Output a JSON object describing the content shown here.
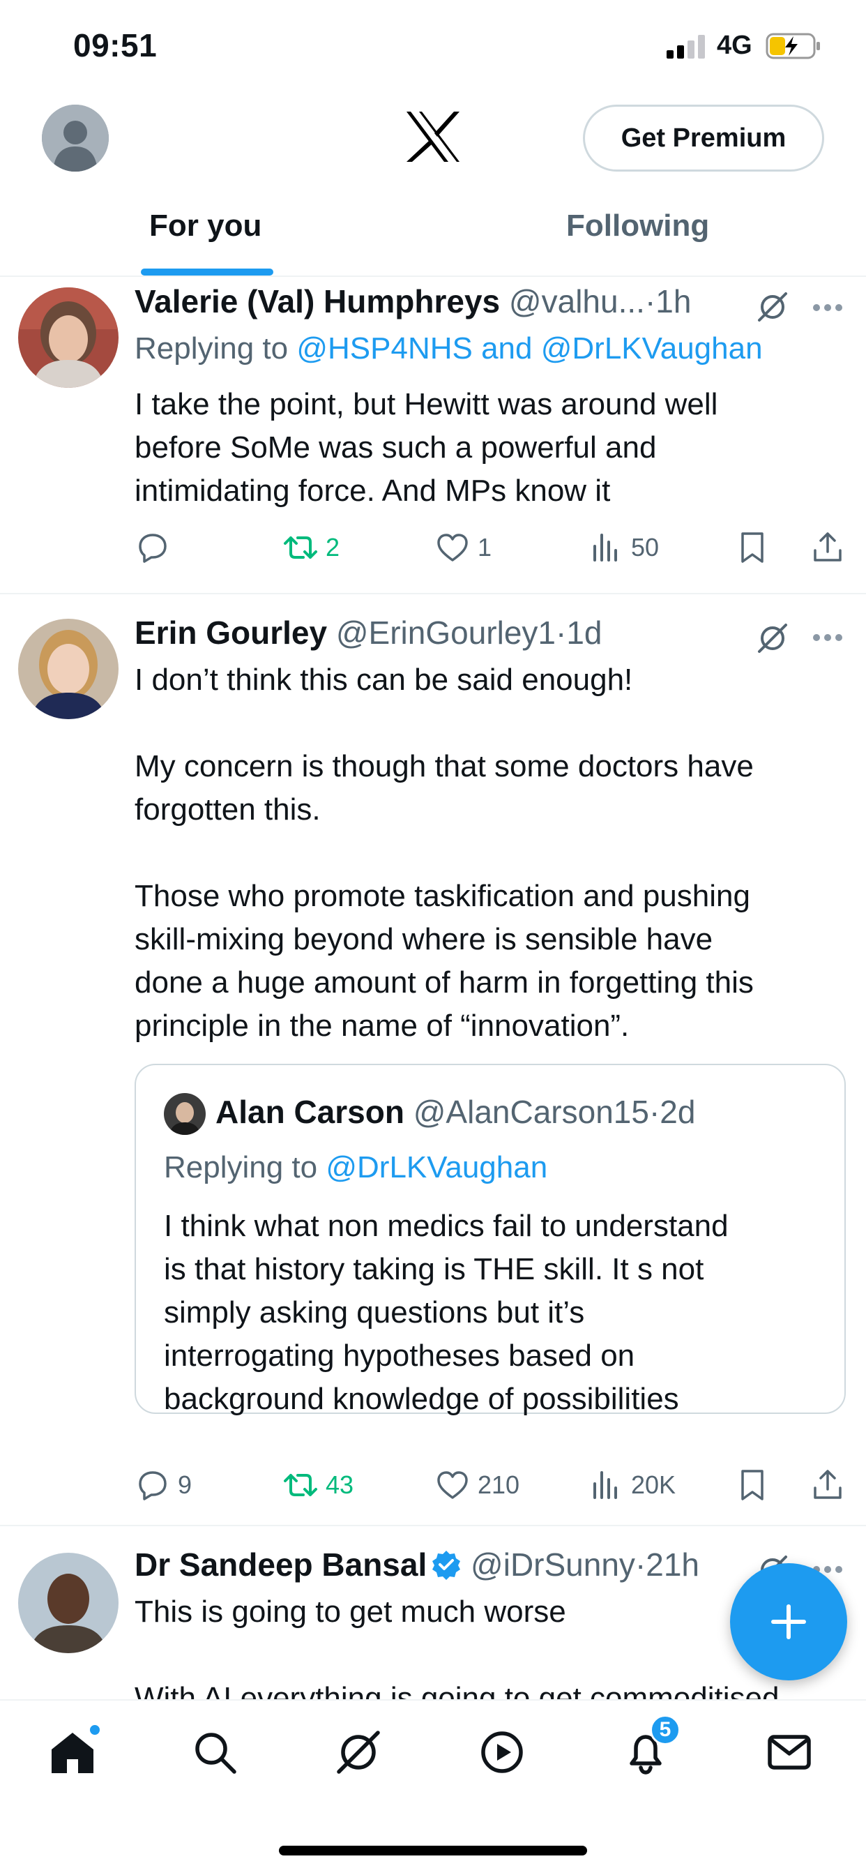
{
  "status_bar": {
    "time": "09:51",
    "network": "4G"
  },
  "header": {
    "premium_label": "Get Premium"
  },
  "tabs": [
    {
      "label": "For you",
      "active": true
    },
    {
      "label": "Following",
      "active": false
    }
  ],
  "posts": [
    {
      "name": "Valerie (Val) Humphreys",
      "handle": "@valhu...",
      "time": "1h",
      "replying_prefix": "Replying to ",
      "replying_to": "@HSP4NHS and @DrLKVaughan",
      "text": "I take the point, but Hewitt was around well\nbefore SoMe was such a powerful and\nintimidating force. And MPs know it",
      "stats": {
        "replies": "",
        "reposts": "2",
        "likes": "1",
        "views": "50"
      }
    },
    {
      "name": "Erin Gourley",
      "handle": "@ErinGourley1",
      "time": "1d",
      "text": "I don’t think this can be said enough!\n\nMy concern is though that some doctors have\nforgotten this.\n\nThose who promote taskification and pushing\nskill-mixing beyond where is sensible have\ndone a huge amount of harm in forgetting this\nprinciple in the name of “innovation”.",
      "quote": {
        "name": "Alan Carson",
        "handle": "@AlanCarson15",
        "time": "2d",
        "replying_prefix": "Replying to ",
        "replying_to": "@DrLKVaughan",
        "text": "I think what non medics fail to understand\nis that history taking is THE skill. It s not\nsimply asking questions but it’s\ninterrogating hypotheses based on\nbackground knowledge of possibilities"
      },
      "stats": {
        "replies": "9",
        "reposts": "43",
        "likes": "210",
        "views": "20K"
      }
    },
    {
      "name": "Dr Sandeep Bansal",
      "handle": "@iDrSunny",
      "time": "21h",
      "verified": true,
      "text": "This is going to get much worse\n\nWith AI everything is going to get commoditised"
    }
  ],
  "separator": "·",
  "bottom_nav": {
    "notifications_count": "5"
  },
  "colors": {
    "accent": "#1d9bf0",
    "repost": "#00ba7c",
    "secondary_text": "#536471"
  },
  "icons": [
    "home-icon",
    "search-icon",
    "grok-icon",
    "play-icon",
    "bell-icon",
    "mail-icon"
  ]
}
